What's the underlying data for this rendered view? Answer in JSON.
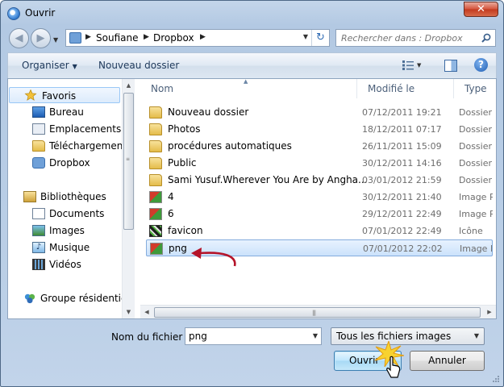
{
  "window": {
    "title": "Ouvrir"
  },
  "address": {
    "crumbs": [
      "Soufiane",
      "Dropbox"
    ],
    "search_placeholder": "Rechercher dans : Dropbox"
  },
  "toolbar": {
    "organise": "Organiser",
    "new_folder": "Nouveau dossier"
  },
  "nav": {
    "items": [
      {
        "label": "Favoris",
        "icon": "star-icon"
      },
      {
        "label": "Bureau",
        "icon": "desktop-icon"
      },
      {
        "label": "Emplacements ré",
        "icon": "recent-places-icon"
      },
      {
        "label": "Téléchargements",
        "icon": "downloads-icon"
      },
      {
        "label": "Dropbox",
        "icon": "dropbox-icon"
      },
      {
        "label": "Bibliothèques",
        "icon": "libraries-icon"
      },
      {
        "label": "Documents",
        "icon": "documents-icon"
      },
      {
        "label": "Images",
        "icon": "pictures-icon"
      },
      {
        "label": "Musique",
        "icon": "music-icon"
      },
      {
        "label": "Vidéos",
        "icon": "videos-icon"
      },
      {
        "label": "Groupe résidentiel",
        "icon": "homegroup-icon"
      }
    ]
  },
  "files": {
    "headers": {
      "name": "Nom",
      "date": "Modifié le",
      "type": "Type"
    },
    "rows": [
      {
        "name": "Nouveau dossier",
        "date": "07/12/2011 19:21",
        "type": "Dossier de",
        "kind": "folder"
      },
      {
        "name": "Photos",
        "date": "18/12/2011 07:17",
        "type": "Dossier de",
        "kind": "folder"
      },
      {
        "name": "procédures automatiques",
        "date": "26/11/2011 15:09",
        "type": "Dossier de",
        "kind": "folder"
      },
      {
        "name": "Public",
        "date": "30/12/2011 14:16",
        "type": "Dossier de",
        "kind": "folder"
      },
      {
        "name": "Sami Yusuf.Wherever You Are by Angha...",
        "date": "03/01/2012 21:59",
        "type": "Dossier de",
        "kind": "folder"
      },
      {
        "name": "4",
        "date": "30/12/2011 21:40",
        "type": "Image PN",
        "kind": "image"
      },
      {
        "name": "6",
        "date": "29/12/2011 22:49",
        "type": "Image PN",
        "kind": "image"
      },
      {
        "name": "favicon",
        "date": "07/01/2012 22:49",
        "type": "Icône",
        "kind": "icon"
      },
      {
        "name": "png",
        "date": "07/01/2012 22:02",
        "type": "Image PN",
        "kind": "image"
      }
    ]
  },
  "bottom": {
    "filename_label": "Nom du fichier :",
    "filename_value": "png",
    "filter": "Tous les fichiers images",
    "open": "Ouvrir",
    "cancel": "Annuler"
  },
  "colors": {
    "selection": "#cbe2fb",
    "arrow": "#b5142a",
    "folder": "#e4bc4a"
  }
}
